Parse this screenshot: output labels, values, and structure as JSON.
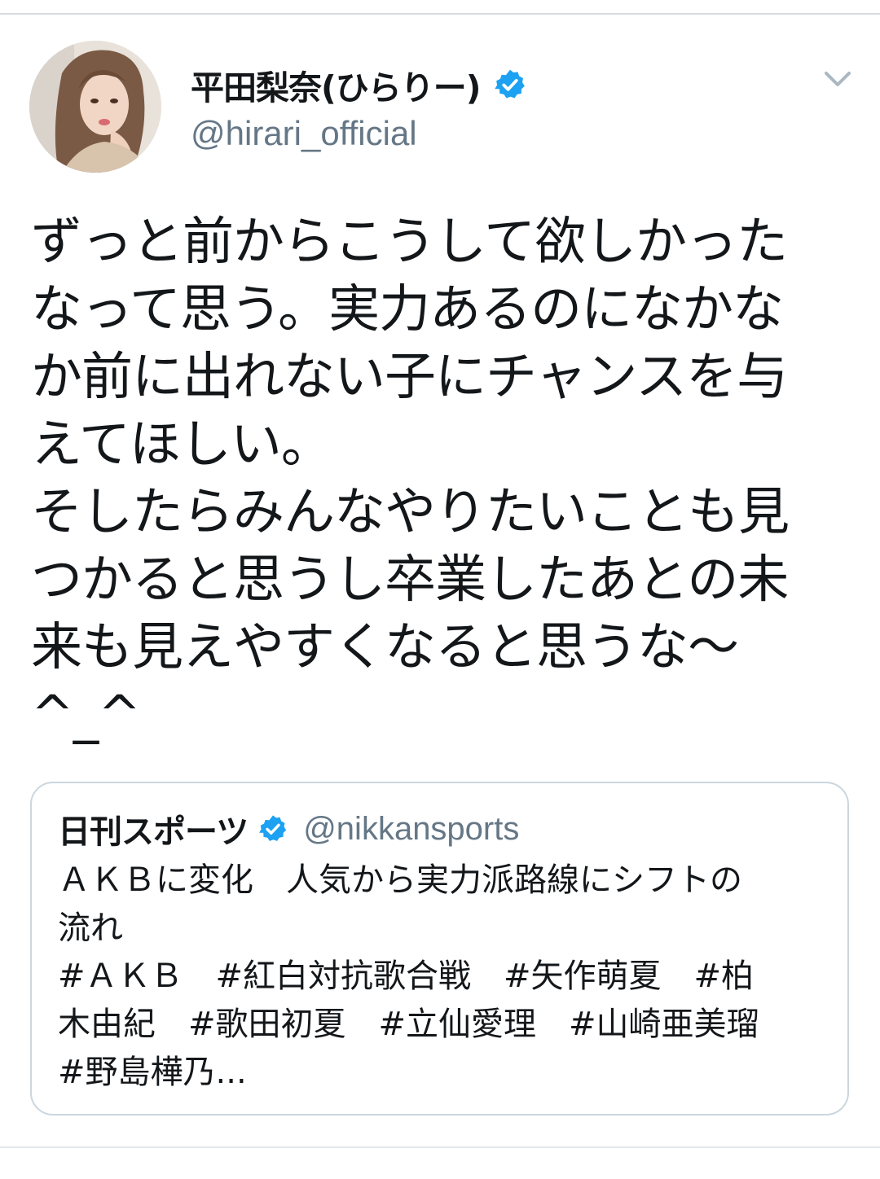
{
  "tweet": {
    "author": {
      "display_name": "平田梨奈(ひらりー)",
      "handle": "@hirari_official",
      "verified": true,
      "avatar_icon": "profile-photo"
    },
    "menu_icon": "chevron-down-icon",
    "text": "ずっと前からこうして欲しかった\nなって思う。実力あるのになかな\nか前に出れない子にチャンスを与\nえてほしい。\nそしたらみんなやりたいことも見\nつかると思うし卒業したあとの未\n来も見えやすくなると思うな〜\n^_^"
  },
  "quoted_tweet": {
    "display_name": "日刊スポーツ",
    "handle": "@nikkansports",
    "verified": true,
    "text": "ＡＫＢに変化　人気から実力派路線にシフトの\n流れ\n#ＡＫＢ　#紅白対抗歌合戦　#矢作萌夏　#柏\n木由紀　#歌田初夏　#立仙愛理　#山崎亜美瑠\n#野島樺乃..."
  },
  "colors": {
    "verified_blue": "#1da1f2",
    "secondary_text": "#657786",
    "primary_text": "#14171a",
    "border": "#ccd6dd"
  }
}
